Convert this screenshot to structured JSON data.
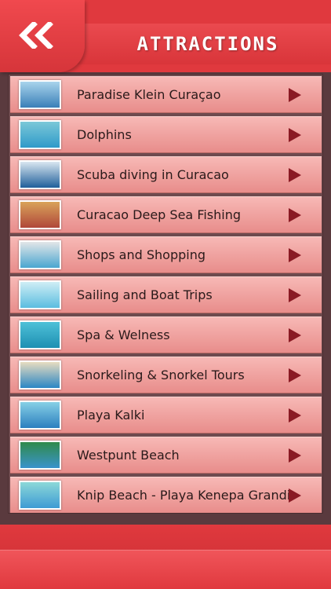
{
  "header": {
    "title": "ATTRACTIONS",
    "back_icon": "double-chevron-left-icon"
  },
  "colors": {
    "header_red": "#e0393e",
    "row_pink": "#f2a9a6",
    "arrow": "#8a1a24",
    "panel_bg": "#6e4a4e"
  },
  "items": [
    {
      "label": "Paradise Klein Curaçao",
      "thumb": [
        "#3a7fb8",
        "#a9d4ec"
      ]
    },
    {
      "label": "Dolphins",
      "thumb": [
        "#2f9ac9",
        "#7bc8d8"
      ]
    },
    {
      "label": "Scuba diving in Curacao",
      "thumb": [
        "#1f5f9a",
        "#d9e6f0"
      ]
    },
    {
      "label": "Curacao Deep Sea Fishing",
      "thumb": [
        "#b0473a",
        "#d9a35a"
      ]
    },
    {
      "label": "Shops and Shopping",
      "thumb": [
        "#4aa6d0",
        "#e3e6e8"
      ]
    },
    {
      "label": "Sailing and Boat Trips",
      "thumb": [
        "#5bbde0",
        "#cfeef5"
      ]
    },
    {
      "label": "Spa & Welness",
      "thumb": [
        "#1d8fb2",
        "#4fc1d8"
      ]
    },
    {
      "label": "Snorkeling & Snorkel Tours",
      "thumb": [
        "#2b86c4",
        "#e7dcc0"
      ]
    },
    {
      "label": "Playa Kalki",
      "thumb": [
        "#2c7fbf",
        "#86d0e6"
      ]
    },
    {
      "label": "Westpunt Beach",
      "thumb": [
        "#3a93cc",
        "#2f8a4a"
      ]
    },
    {
      "label": "Knip Beach - Playa Kenepa Grandi",
      "thumb": [
        "#3d9bd4",
        "#8cd8d8"
      ]
    }
  ]
}
